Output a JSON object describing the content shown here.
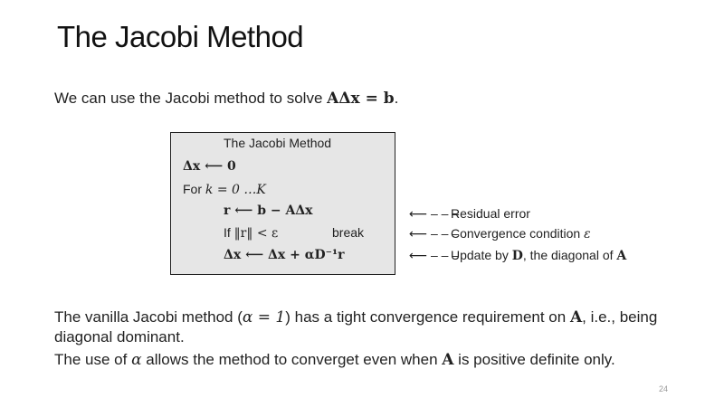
{
  "slide": {
    "title": "The Jacobi Method",
    "page_number": "24"
  },
  "intro": {
    "text": "We can use the Jacobi method to solve ",
    "equation": "AΔx = b",
    "end": "."
  },
  "algorithm": {
    "heading": "The Jacobi Method",
    "init": "Δx ⟵ 0",
    "for_prefix": "For ",
    "for_range": "k = 0 …K",
    "residual": "r ⟵ b − AΔx",
    "if_prefix": "If ",
    "if_condition": "‖r‖ < ε",
    "break": "break",
    "update": "Δx ⟵ Δx + αD⁻¹r"
  },
  "annotations": [
    {
      "arrow": "⟵ – – –",
      "text": "Residual error"
    },
    {
      "arrow": "⟵ – – –",
      "text": "Convergence condition ",
      "symbol": "ε"
    },
    {
      "arrow": "⟵ – – –",
      "text": "Update by ",
      "d": "D",
      "mid": ", the diagonal of ",
      "a": "A"
    }
  ],
  "paragraphs": {
    "p1_a": "The vanilla Jacobi method (",
    "p1_alpha": "α = 1",
    "p1_b": ") has a tight convergence requirement on ",
    "p1_A": "A",
    "p1_c": ", i.e., being diagonal dominant.",
    "p2_a": "The use of ",
    "p2_alpha": "α",
    "p2_b": " allows the method to converget even when ",
    "p2_A": "A",
    "p2_c": " is positive definite only."
  }
}
